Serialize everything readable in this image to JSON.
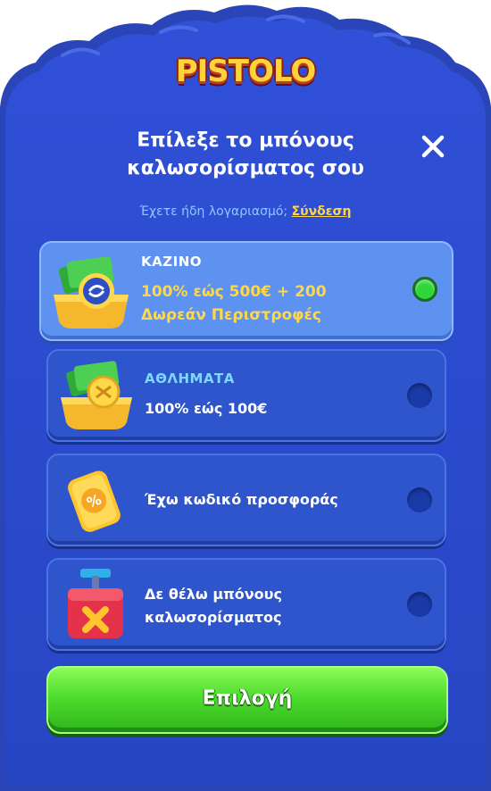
{
  "brand": {
    "logo_text": "PISTOLO"
  },
  "header": {
    "title_line1": "Επίλεξε το μπόνους",
    "title_line2": "καλωσορίσματος σου",
    "close_icon": "close-icon"
  },
  "login": {
    "prompt": "Έχετε ήδη λογαριασμό;",
    "link": "Σύνδεση"
  },
  "options": [
    {
      "heading": "ΚΑΖΙΝΟ",
      "line1": "100% εώς 500€ + 200",
      "line2": "Δωρεάν Περιστροφές",
      "icon": "casino-chest-icon",
      "selected": true
    },
    {
      "heading": "ΑΘΛΗΜΑΤΑ",
      "line1": "100% εώς 100€",
      "icon": "sports-chest-icon",
      "selected": false
    },
    {
      "line1": "Έχω κωδικό προσφοράς",
      "icon": "promo-ticket-icon",
      "selected": false
    },
    {
      "line1": "Δε θέλω μπόνους",
      "line2": "καλωσορίσματος",
      "icon": "no-bonus-box-icon",
      "selected": false
    }
  ],
  "cta": {
    "label": "Επιλογή"
  },
  "colors": {
    "panel": "#2a4fd0",
    "selected_card": "#5d92f0",
    "accent_gold": "#ffd84a",
    "radio_on": "#2fd63a",
    "cta_green": "#4fdc2f"
  }
}
